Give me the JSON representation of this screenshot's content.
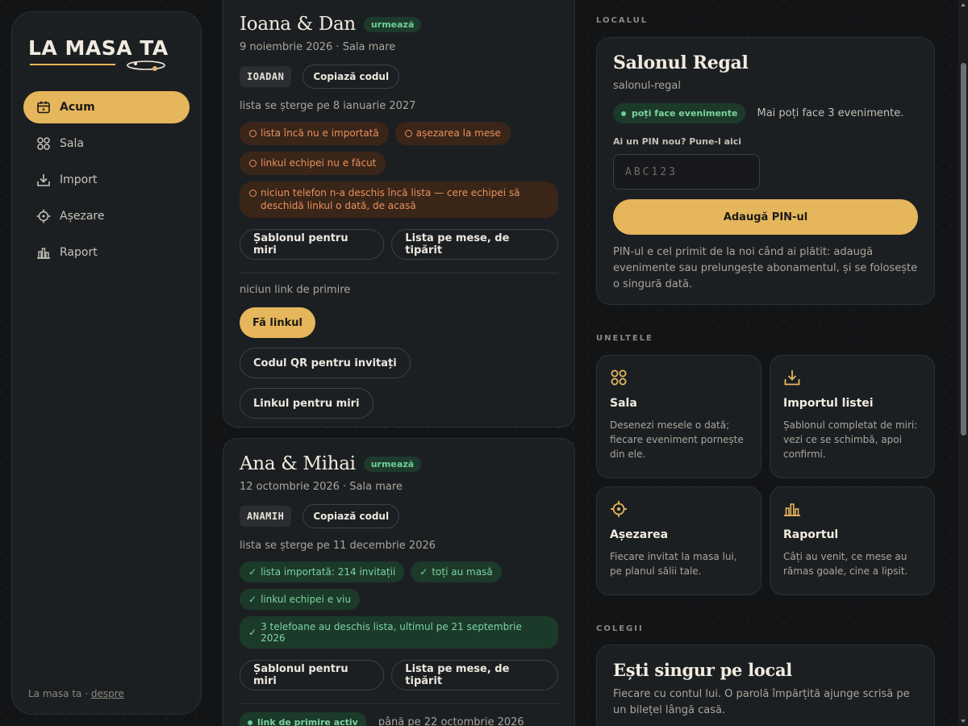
{
  "brand": {
    "logo_text": "LA MASA TA"
  },
  "sidebar": {
    "items": [
      {
        "label": "Acum",
        "icon": "calendar-icon",
        "active": true
      },
      {
        "label": "Sala",
        "icon": "tables-icon"
      },
      {
        "label": "Import",
        "icon": "download-icon"
      },
      {
        "label": "Așezare",
        "icon": "target-icon"
      },
      {
        "label": "Raport",
        "icon": "chart-icon"
      }
    ],
    "footer_text": "La masa ta ·",
    "footer_link": "despre"
  },
  "events": [
    {
      "title": "Ioana & Dan",
      "badge": "urmează",
      "subtitle": "9 noiembrie 2026 · Sala mare",
      "code": "IOADAN",
      "copy_label": "Copiază codul",
      "delete_note": "lista se șterge pe 8 ianuarie 2027",
      "warnings": [
        "lista încă nu e importată",
        "așezarea la mese",
        "linkul echipei nu e făcut",
        "niciun telefon n-a deschis încă lista — cere echipei să deschidă linkul o dată, de acasă"
      ],
      "btn_template": "Șablonul pentru miri",
      "btn_print": "Lista pe mese, de tipărit",
      "no_link": "niciun link de primire",
      "btn_make_link": "Fă linkul",
      "btn_qr": "Codul QR pentru invitați",
      "btn_couple_link": "Linkul pentru miri"
    },
    {
      "title": "Ana & Mihai",
      "badge": "urmează",
      "subtitle": "12 octombrie 2026 · Sala mare",
      "code": "ANAMIH",
      "copy_label": "Copiază codul",
      "delete_note": "lista se șterge pe 11 decembrie 2026",
      "oks": [
        "lista importată: 214 invitații",
        "toți au masă",
        "linkul echipei e viu",
        "3 telefoane au deschis lista, ultimul pe 21 septembrie 2026"
      ],
      "btn_template": "Șablonul pentru miri",
      "btn_print": "Lista pe mese, de tipărit",
      "link_active": "link de primire activ",
      "link_until": "până pe 22 octombrie 2026"
    }
  ],
  "venue": {
    "section_label": "LOCALUL",
    "name": "Salonul Regal",
    "slug": "salonul-regal",
    "status": "poți face evenimente",
    "remaining": "Mai poți face 3 evenimente.",
    "pin_label": "Ai un PIN nou? Pune-l aici",
    "pin_placeholder": "ABC123",
    "pin_button": "Adaugă PIN-ul",
    "pin_note": "PIN-ul e cel primit de la noi când ai plătit: adaugă evenimente sau prelungește abonamentul, și se folosește o singură dată."
  },
  "tools": {
    "section_label": "UNELTELE",
    "items": [
      {
        "title": "Sala",
        "desc": "Desenezi mesele o dată; fiecare eveniment pornește din ele.",
        "icon": "tables-icon"
      },
      {
        "title": "Importul listei",
        "desc": "Șablonul completat de miri: vezi ce se schimbă, apoi confirmi.",
        "icon": "download-icon"
      },
      {
        "title": "Așezarea",
        "desc": "Fiecare invitat la masa lui, pe planul sălii tale.",
        "icon": "target-icon"
      },
      {
        "title": "Raportul",
        "desc": "Câți au venit, ce mese au rămas goale, cine a lipsit.",
        "icon": "chart-icon"
      }
    ]
  },
  "colleagues": {
    "section_label": "COLEGII",
    "title": "Ești singur pe local",
    "desc": "Fiecare cu contul lui. O parolă împărțită ajunge scrisă pe un bilețel lângă casă."
  },
  "colors": {
    "accent": "#e6b65c",
    "ok_bg": "#1c3a2a",
    "ok_text": "#7bd49f",
    "warn_bg": "#3a2519",
    "warn_text": "#e8925c",
    "card_bg": "#1c1f22",
    "page_bg": "#121416"
  }
}
